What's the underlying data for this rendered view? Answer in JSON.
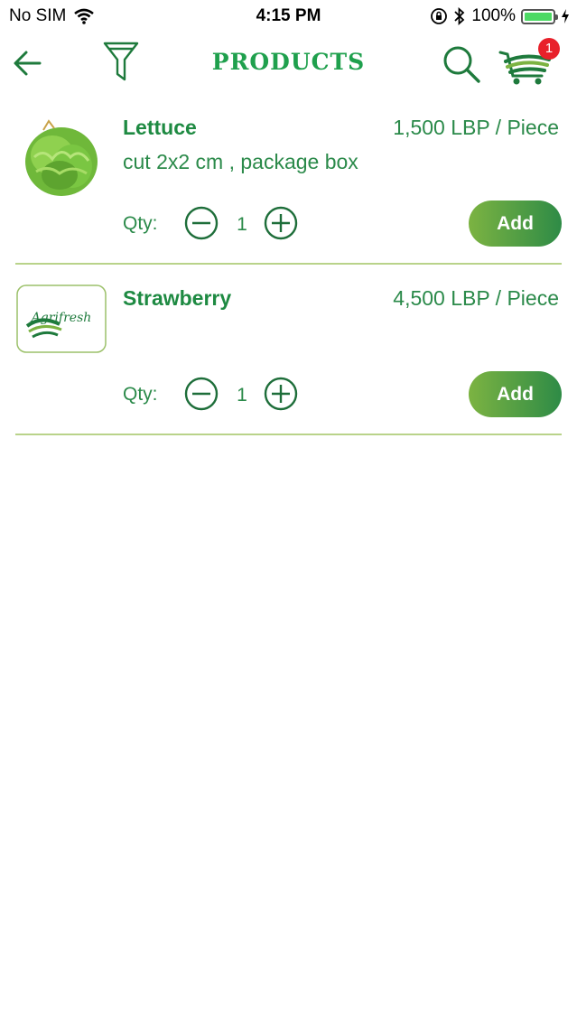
{
  "status_bar": {
    "carrier": "No SIM",
    "time": "4:15 PM",
    "battery_text": "100%",
    "battery_level": 1.0,
    "icons": [
      "wifi-icon",
      "orientation-lock-icon",
      "bluetooth-icon",
      "battery-icon",
      "charging-icon"
    ]
  },
  "navbar": {
    "title": "PRODUCTS",
    "cart_count": "1",
    "icons": [
      "back-arrow-icon",
      "filter-icon",
      "search-icon",
      "cart-icon"
    ],
    "colors": {
      "accent": "#1fa04d",
      "badge": "#e8202a"
    }
  },
  "products": [
    {
      "name": "Lettuce",
      "price": "1,500 LBP / Piece",
      "description": "cut 2x2 cm , package box",
      "qty_label": "Qty:",
      "qty": "1",
      "add_label": "Add",
      "image": "lettuce-image"
    },
    {
      "name": "Strawberry",
      "price": "4,500 LBP / Piece",
      "description": "",
      "qty_label": "Qty:",
      "qty": "1",
      "add_label": "Add",
      "image": "agrifresh-logo",
      "logo_text": "Agrifresh"
    }
  ]
}
